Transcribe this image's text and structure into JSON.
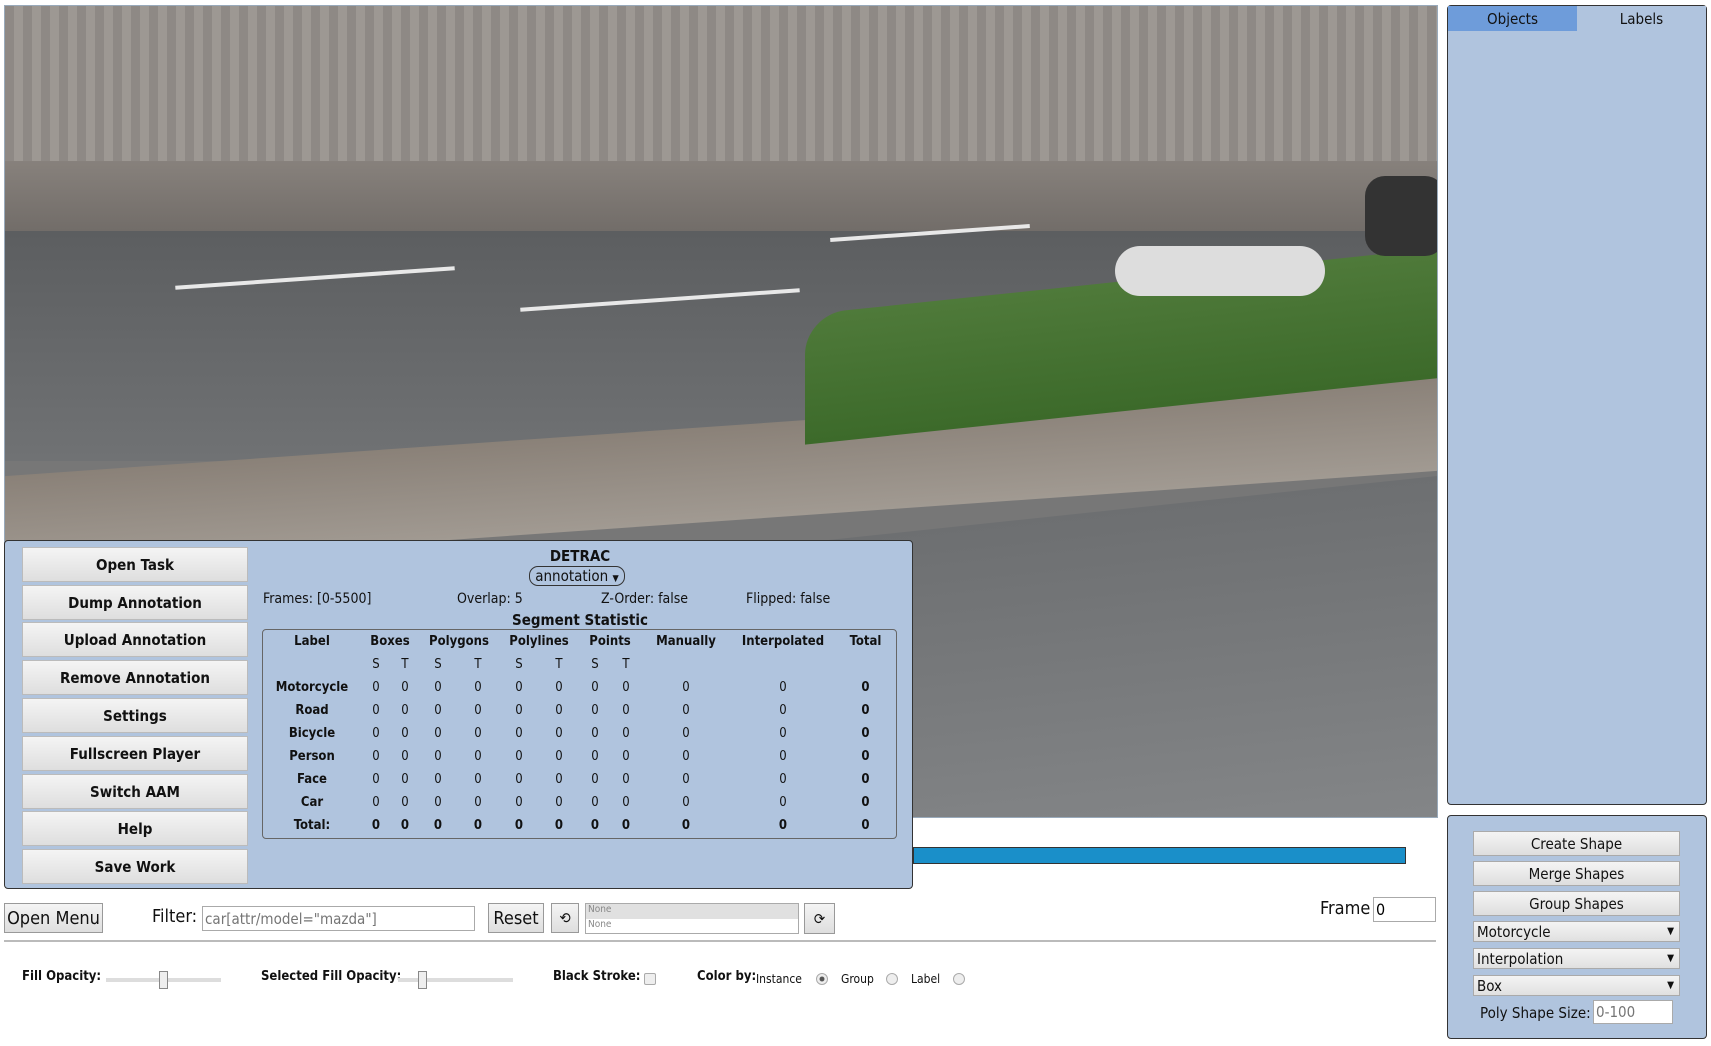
{
  "menu": {
    "buttons": [
      "Open Task",
      "Dump Annotation",
      "Upload Annotation",
      "Remove Annotation",
      "Settings",
      "Fullscreen Player",
      "Switch AAM",
      "Help",
      "Save Work"
    ],
    "task_name": "DETRAC",
    "mode_select": "annotation",
    "frames": "Frames: [0-5500]",
    "overlap": "Overlap: 5",
    "zorder": "Z-Order: false",
    "flipped": "Flipped: false",
    "stat_title": "Segment Statistic",
    "table": {
      "headers": [
        "Label",
        "Boxes",
        "Polygons",
        "Polylines",
        "Points",
        "Manually",
        "Interpolated",
        "Total"
      ],
      "sub": [
        "S",
        "T",
        "S",
        "T",
        "S",
        "T",
        "S",
        "T"
      ],
      "rows": [
        [
          "Motorcycle",
          "0",
          "0",
          "0",
          "0",
          "0",
          "0",
          "0",
          "0",
          "0",
          "0",
          "0"
        ],
        [
          "Road",
          "0",
          "0",
          "0",
          "0",
          "0",
          "0",
          "0",
          "0",
          "0",
          "0",
          "0"
        ],
        [
          "Bicycle",
          "0",
          "0",
          "0",
          "0",
          "0",
          "0",
          "0",
          "0",
          "0",
          "0",
          "0"
        ],
        [
          "Person",
          "0",
          "0",
          "0",
          "0",
          "0",
          "0",
          "0",
          "0",
          "0",
          "0",
          "0"
        ],
        [
          "Face",
          "0",
          "0",
          "0",
          "0",
          "0",
          "0",
          "0",
          "0",
          "0",
          "0",
          "0"
        ],
        [
          "Car",
          "0",
          "0",
          "0",
          "0",
          "0",
          "0",
          "0",
          "0",
          "0",
          "0",
          "0"
        ],
        [
          "Total:",
          "0",
          "0",
          "0",
          "0",
          "0",
          "0",
          "0",
          "0",
          "0",
          "0",
          "0"
        ]
      ]
    }
  },
  "player": {
    "progress": 0,
    "progress_color": "#1a8fc9"
  },
  "toolbar": {
    "open_menu": "Open Menu",
    "filter_label": "Filter:",
    "filter_placeholder": "car[attr/model=\"mazda\"]",
    "reset": "Reset",
    "history": [
      "None",
      "None"
    ],
    "frame_label": "Frame",
    "frame_value": "0"
  },
  "settings": {
    "fill_opacity": "Fill Opacity:",
    "fill_opacity_value": 0.5,
    "selected_fill_opacity": "Selected Fill Opacity:",
    "selected_fill_opacity_value": 0.2,
    "black_stroke": "Black Stroke:",
    "color_by": "Color by:",
    "color_options": [
      "Instance",
      "Group",
      "Label"
    ],
    "color_selected": "Instance"
  },
  "sidebar": {
    "tabs": [
      "Objects",
      "Labels"
    ],
    "active_tab": "Objects"
  },
  "shape_panel": {
    "create": "Create Shape",
    "merge": "Merge Shapes",
    "group": "Group Shapes",
    "label_select": "Motorcycle",
    "mode_select": "Interpolation",
    "shape_select": "Box",
    "poly_label": "Poly Shape Size:",
    "poly_placeholder": "0-100"
  }
}
